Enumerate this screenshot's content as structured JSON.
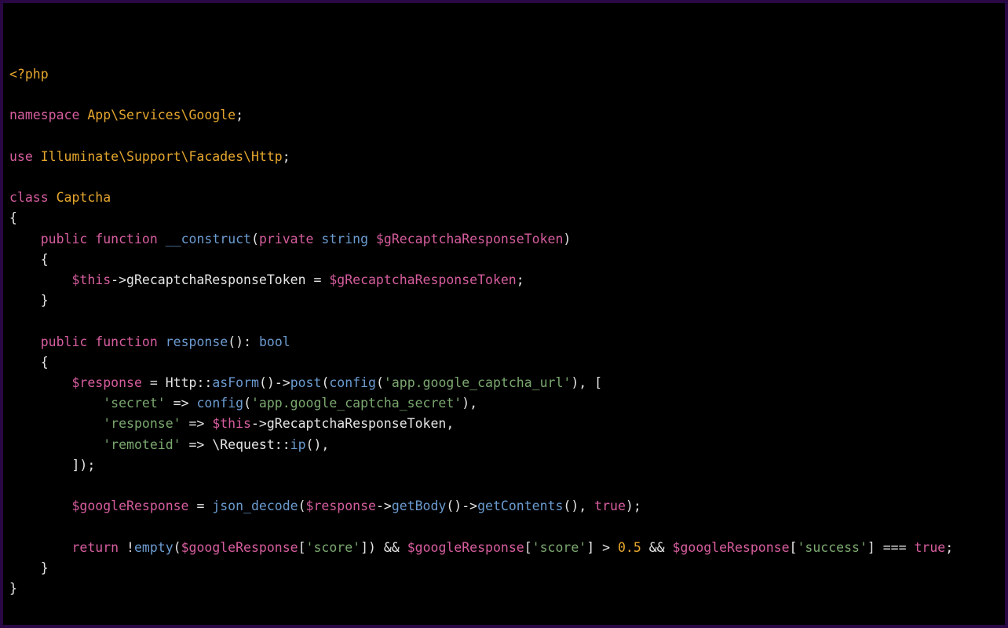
{
  "code": {
    "open_tag": "<?php",
    "namespace_kw": "namespace",
    "namespace_path": "App\\Services\\Google",
    "use_kw": "use",
    "use_path": "Illuminate\\Support\\Facades\\Http",
    "class_kw": "class",
    "class_name": "Captcha",
    "public_kw": "public",
    "function_kw": "function",
    "private_kw": "private",
    "string_kw": "string",
    "bool_kw": "bool",
    "construct_name": "__construct",
    "response_name": "response",
    "var_gRecaptcha": "$gRecaptchaResponseToken",
    "var_this": "$this",
    "var_response": "$response",
    "var_googleResponse": "$googleResponse",
    "prop_gRecaptcha": "gRecaptchaResponseToken",
    "http_class": "Http",
    "asForm_method": "asForm",
    "post_method": "post",
    "config_fn": "config",
    "request_class": "\\Request",
    "ip_method": "ip",
    "json_decode_fn": "json_decode",
    "getBody_method": "getBody",
    "getContents_method": "getContents",
    "return_kw": "return",
    "empty_fn": "empty",
    "true_kw": "true",
    "str_app_google_captcha_url": "'app.google_captcha_url'",
    "str_secret": "'secret'",
    "str_app_google_captcha_secret": "'app.google_captcha_secret'",
    "str_response": "'response'",
    "str_remoteid": "'remoteid'",
    "str_score1": "'score'",
    "str_score2": "'score'",
    "str_success": "'success'",
    "num_threshold": "0.5",
    "semicolon": ";",
    "open_paren": "(",
    "close_paren": ")",
    "open_brace": "{",
    "close_brace": "}",
    "open_bracket": "[",
    "close_bracket": "]",
    "arrow": "->",
    "fat_arrow": "=>",
    "dbl_colon": "::",
    "comma": ",",
    "equals": "=",
    "colon": ":",
    "bang": "!",
    "and_op": "&&",
    "gt": ">",
    "triple_eq": "===",
    "empty_line": ""
  }
}
